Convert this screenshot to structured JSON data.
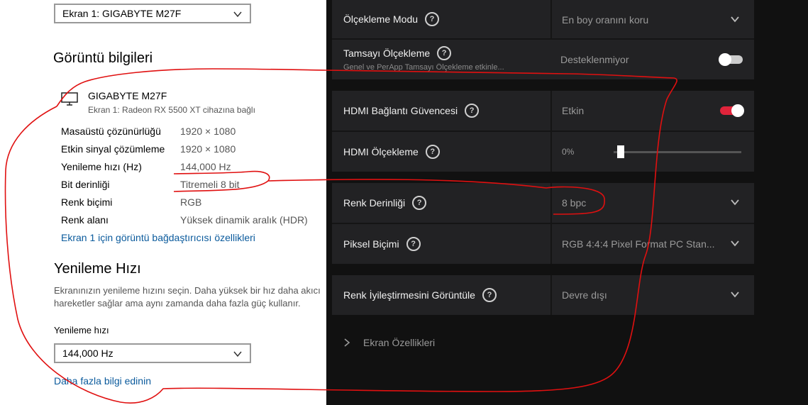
{
  "left": {
    "display_select": "Ekran 1: GIGABYTE M27F",
    "display_info_title": "Görüntü bilgileri",
    "monitor": {
      "name": "GIGABYTE M27F",
      "subtitle": "Ekran 1: Radeon RX 5500 XT cihazına bağlı"
    },
    "info_rows": [
      {
        "label": "Masaüstü çözünürlüğü",
        "value": "1920 × 1080"
      },
      {
        "label": "Etkin sinyal çözümleme",
        "value": "1920 × 1080"
      },
      {
        "label": "Yenileme hızı (Hz)",
        "value": "144,000 Hz"
      },
      {
        "label": "Bit derinliği",
        "value": "Titremeli 8 bit"
      },
      {
        "label": "Renk biçimi",
        "value": "RGB"
      },
      {
        "label": "Renk alanı",
        "value": "Yüksek dinamik aralık (HDR)"
      }
    ],
    "adapter_link": "Ekran 1 için görüntü bağdaştırıcısı özellikleri",
    "refresh_title": "Yenileme Hızı",
    "refresh_desc_1": "Ekranınızın yenileme hızını seçin. Daha yüksek bir hız daha akıcı",
    "refresh_desc_2": "hareketler sağlar ama aynı zamanda daha fazla güç kullanır.",
    "refresh_label": "Yenileme hızı",
    "refresh_select": "144,000 Hz",
    "more_info_link": "Daha fazla bilgi edinin"
  },
  "right": {
    "scaling_mode": {
      "label": "Ölçekleme Modu",
      "value": "En boy oranını koru"
    },
    "integer_scaling": {
      "label": "Tamsayı Ölçekleme",
      "sub": "Genel ve PerApp Tamsayı Ölçekleme etkinle...",
      "value": "Desteklenmiyor",
      "enabled": false
    },
    "hdmi_link": {
      "label": "HDMI Bağlantı Güvencesi",
      "value": "Etkin",
      "enabled": true
    },
    "hdmi_scaling": {
      "label": "HDMI Ölçekleme",
      "value": "0%",
      "level": 0
    },
    "color_depth": {
      "label": "Renk Derinliği",
      "value": "8 bpc"
    },
    "pixel_format": {
      "label": "Piksel Biçimi",
      "value": "RGB 4:4:4 Pixel Format PC Stan..."
    },
    "color_enhance": {
      "label": "Renk İyileştirmesini Görüntüle",
      "value": "Devre dışı"
    },
    "display_props": "Ekran Özellikleri"
  },
  "colors": {
    "amd_bg": "#111111",
    "amd_card": "#222224",
    "toggle_on": "#e0243b",
    "toggle_off": "#cccccc",
    "link": "#0a5a9c",
    "annotation": "#e01010"
  }
}
